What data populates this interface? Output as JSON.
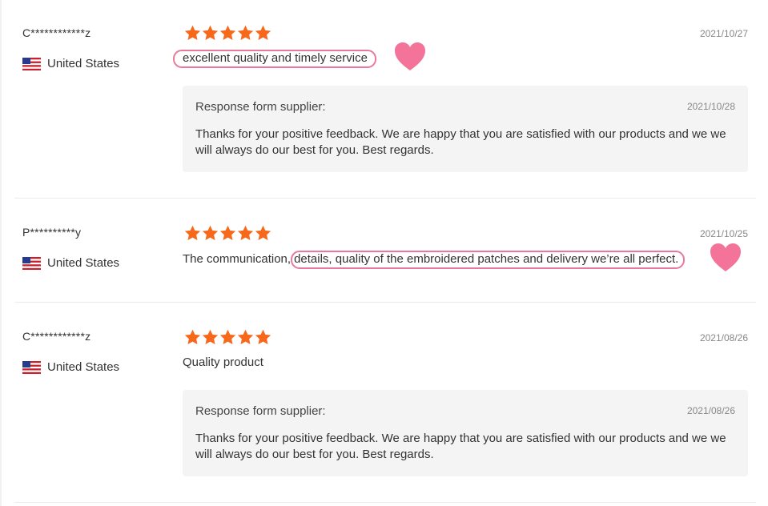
{
  "colors": {
    "star": "#f7681a",
    "heart": "#f47399",
    "highlight": "#e8799a",
    "reply_bg": "#f4f4f4"
  },
  "reviews": [
    {
      "username": "C************z",
      "country": "United States",
      "rating": 5,
      "date": "2021/10/27",
      "comment_plain": "",
      "comment_highlight": "excellent quality and timely service",
      "reply": {
        "title": "Response form supplier:",
        "date": "2021/10/28",
        "text": "Thanks for your positive feedback. We are happy that you are satisfied with our products and we we will always do our best for you. Best regards."
      }
    },
    {
      "username": "P**********y",
      "country": "United States",
      "rating": 5,
      "date": "2021/10/25",
      "comment_plain": "The communication,",
      "comment_highlight": "details, quality of the embroidered patches and delivery we’re all perfect."
    },
    {
      "username": "C************z",
      "country": "United States",
      "rating": 5,
      "date": "2021/08/26",
      "comment_plain": "Quality product",
      "reply": {
        "title": "Response form supplier:",
        "date": "2021/08/26",
        "text": "Thanks for your positive feedback. We are happy that you are satisfied with our products and we we will always do our best for you. Best regards."
      }
    }
  ]
}
